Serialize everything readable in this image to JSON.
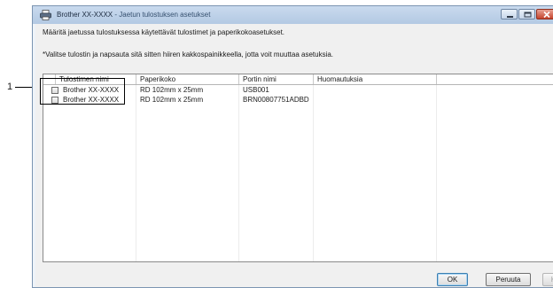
{
  "callout": {
    "label": "1"
  },
  "window": {
    "title_main": "Brother XX-XXXX",
    "title_sep": " - ",
    "title_sub": "Jaetun tulostuksen asetukset"
  },
  "instructions": {
    "line1": "Määritä jaetussa tulostuksessa käytettävät tulostimet ja paperikokoasetukset.",
    "line2": "*Valitse tulostin ja napsauta sitä sitten hiiren kakkospainikkeella, jotta voit muuttaa asetuksia."
  },
  "table": {
    "columns": [
      "Tulostimen nimi",
      "Paperikoko",
      "Portin nimi",
      "Huomautuksia",
      ""
    ],
    "rows": [
      {
        "checked": false,
        "printer": "Brother XX-XXXX",
        "paper": "RD 102mm x 25mm",
        "port": "USB001",
        "notes": ""
      },
      {
        "checked": false,
        "printer": "Brother XX-XXXX",
        "paper": "RD 102mm x 25mm",
        "port": "BRN00807751ADBD",
        "notes": ""
      }
    ]
  },
  "buttons": {
    "ok": "OK",
    "cancel": "Peruuta",
    "apply": "Käytä"
  },
  "icons": {
    "app": "printer-icon",
    "minimize": "minimize-icon",
    "maximize": "maximize-icon",
    "close": "close-icon"
  },
  "colors": {
    "titlebar": "#b3c9e3",
    "close_button": "#c4432c",
    "default_button_border": "#3c7fb1"
  }
}
